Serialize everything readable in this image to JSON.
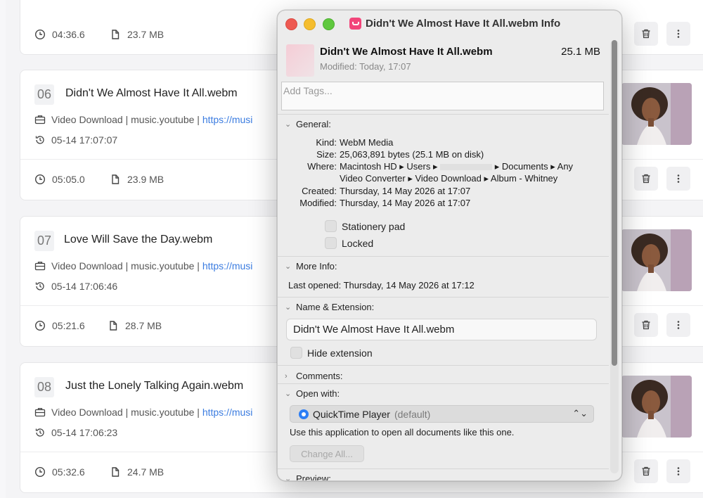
{
  "list": {
    "items": [
      {
        "index": "06",
        "title": "Didn't We Almost Have It All.webm",
        "source_prefix": "Video Download | music.youtube | ",
        "source_link": "https://musi",
        "datetime": "05-14 17:07:07",
        "duration": "05:05.0",
        "size": "23.9 MB"
      },
      {
        "index": "07",
        "title": "Love Will Save the Day.webm",
        "source_prefix": "Video Download | music.youtube | ",
        "source_link": "https://musi",
        "datetime": "05-14 17:06:46",
        "duration": "05:21.6",
        "size": "28.7 MB"
      },
      {
        "index": "08",
        "title": "Just the Lonely Talking Again.webm",
        "source_prefix": "Video Download | music.youtube | ",
        "source_link": "https://musi",
        "datetime": "05-14 17:06:23",
        "duration": "05:32.6",
        "size": "24.7 MB"
      }
    ],
    "first_partial": {
      "duration": "04:36.6",
      "size": "23.7 MB"
    },
    "actions": {
      "delete_icon": "trash-icon",
      "more_icon": "more-vertical-icon"
    }
  },
  "info_window": {
    "title": "Didn't We Almost Have It All.webm Info",
    "file_name": "Didn't We Almost Have It All.webm",
    "file_size": "25.1 MB",
    "modified_short": "Modified: Today, 17:07",
    "tags_placeholder": "Add Tags...",
    "general": {
      "header": "General:",
      "kind_label": "Kind:",
      "kind": "WebM Media",
      "size_label": "Size:",
      "size": "25,063,891 bytes (25.1 MB on disk)",
      "where_label": "Where:",
      "where_line1_a": "Macintosh HD ▸ Users ▸",
      "where_line1_b": "▸ Documents ▸ Any",
      "where_line2": "Video Converter ▸ Video Download ▸ Album - Whitney",
      "created_label": "Created:",
      "created": "Thursday, 14 May 2026 at 17:07",
      "modified_label": "Modified:",
      "modified": "Thursday, 14 May 2026 at 17:07",
      "stationery": "Stationery pad",
      "locked": "Locked"
    },
    "more_info": {
      "header": "More Info:",
      "last_opened_label": "Last opened:",
      "last_opened": "Thursday, 14 May 2026 at 17:12"
    },
    "name_ext": {
      "header": "Name & Extension:",
      "value": "Didn't We Almost Have It All.webm",
      "hide_ext": "Hide extension"
    },
    "comments": {
      "header": "Comments:"
    },
    "open_with": {
      "header": "Open with:",
      "app": "QuickTime Player",
      "app_default": "(default)",
      "desc": "Use this application to open all documents like this one.",
      "change_all": "Change All..."
    },
    "preview": {
      "header": "Preview:"
    }
  }
}
